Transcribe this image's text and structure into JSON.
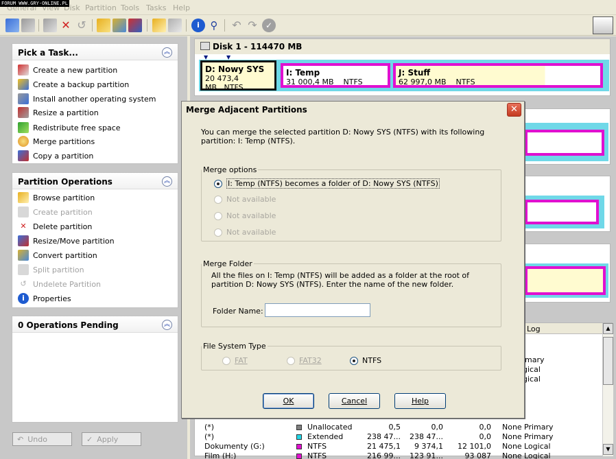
{
  "watermark": "FORUM WWW.GRY-ONLINE.PL",
  "menu": [
    "General",
    "View",
    "Disk",
    "Partition",
    "Tools",
    "Tasks",
    "Help"
  ],
  "colors": {
    "magenta": "#e010d0",
    "cyan": "#6fd8e8",
    "yellow": "#fffbd0",
    "dialogbg": "#ece9d8",
    "panelbg": "#c8c8c8",
    "link": "#1e3fa8"
  },
  "left": {
    "pick": {
      "title": "Pick a Task...",
      "items": [
        {
          "label": "Create a new partition",
          "icon": "create-partition-icon"
        },
        {
          "label": "Create a backup partition",
          "icon": "backup-partition-icon"
        },
        {
          "label": "Install another operating system",
          "icon": "install-os-icon"
        },
        {
          "label": "Resize a partition",
          "icon": "resize-icon"
        },
        {
          "label": "Redistribute free space",
          "icon": "redistribute-icon"
        },
        {
          "label": "Merge partitions",
          "icon": "merge-icon"
        },
        {
          "label": "Copy a partition",
          "icon": "copy-icon"
        }
      ]
    },
    "ops": {
      "title": "Partition Operations",
      "items": [
        {
          "label": "Browse partition",
          "enabled": true
        },
        {
          "label": "Create partition",
          "enabled": false
        },
        {
          "label": "Delete partition",
          "enabled": true
        },
        {
          "label": "Resize/Move partition",
          "enabled": true
        },
        {
          "label": "Convert partition",
          "enabled": true
        },
        {
          "label": "Split partition",
          "enabled": false
        },
        {
          "label": "Undelete Partition",
          "enabled": false
        },
        {
          "label": "Properties",
          "enabled": true
        }
      ]
    },
    "pending": {
      "title": "0 Operations Pending"
    },
    "undo": "Undo",
    "apply": "Apply"
  },
  "disk": {
    "title": "Disk 1 - 114470 MB",
    "partitions": [
      {
        "name": "D:  Nowy SYS",
        "size": "20 473,4 MB",
        "fs": "NTFS"
      },
      {
        "name": "I:  Temp",
        "size": "31 000,4 MB",
        "fs": "NTFS"
      },
      {
        "name": "J:  Stuff",
        "size": "62 997,0 MB",
        "fs": "NTFS"
      }
    ]
  },
  "grid": {
    "col_log": "Log",
    "right_types": [
      "imary",
      "gical",
      "gical"
    ],
    "rows": [
      {
        "name": "(*)",
        "color": "#808080",
        "fs": "Unallocated",
        "size": "0,5",
        "used": "0,0",
        "unused": "0,0",
        "status": "None",
        "type": "Primary"
      },
      {
        "name": "(*)",
        "color": "#22d6e6",
        "fs": "Extended",
        "size": "238 47...",
        "used": "238 47...",
        "unused": "0,0",
        "status": "None",
        "type": "Primary"
      },
      {
        "name": "Dokumenty (G:)",
        "color": "#e010d0",
        "fs": "NTFS",
        "size": "21 475,1",
        "used": "9 374,1",
        "unused": "12 101,0",
        "status": "None",
        "type": "Logical"
      },
      {
        "name": "Film (H:)",
        "color": "#e010d0",
        "fs": "NTFS",
        "size": "216 99...",
        "used": "123 91...",
        "unused": "93 087",
        "status": "None",
        "type": "Logical"
      }
    ]
  },
  "dialog": {
    "title": "Merge Adjacent Partitions",
    "intro": "You can merge the selected partition  D: Nowy SYS (NTFS)  with its following partition:  I: Temp (NTFS).",
    "options_legend": "Merge options",
    "options": [
      {
        "label": "I: Temp (NTFS)     becomes a folder of     D: Nowy SYS (NTFS)",
        "checked": true,
        "enabled": true
      },
      {
        "label": "Not available",
        "checked": false,
        "enabled": false
      },
      {
        "label": "Not available",
        "checked": false,
        "enabled": false
      },
      {
        "label": "Not available",
        "checked": false,
        "enabled": false
      }
    ],
    "folder_legend": "Merge Folder",
    "folder_text": "All the files on  I: Temp (NTFS)  will be added as a folder at the root of partition  D: Nowy SYS (NTFS).  Enter the name of the new folder.",
    "folder_label": "Folder Name:",
    "folder_value": "",
    "fs_legend": "File System Type",
    "fs_options": [
      {
        "label": "FAT",
        "checked": false,
        "enabled": false
      },
      {
        "label": "FAT32",
        "checked": false,
        "enabled": false
      },
      {
        "label": "NTFS",
        "checked": true,
        "enabled": true
      }
    ],
    "ok": "OK",
    "cancel": "Cancel",
    "help": "Help"
  }
}
